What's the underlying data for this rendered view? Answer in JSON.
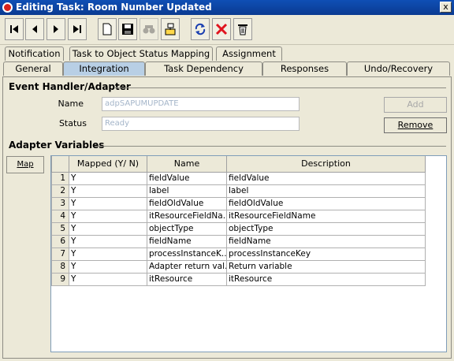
{
  "window": {
    "title": "Editing Task: Room Number Updated",
    "close_glyph": "x"
  },
  "toolbar": {
    "buttons": [
      {
        "name": "first-record-icon"
      },
      {
        "name": "previous-record-icon"
      },
      {
        "name": "next-record-icon"
      },
      {
        "name": "last-record-icon"
      },
      {
        "name": "new-icon"
      },
      {
        "name": "save-icon"
      },
      {
        "name": "find-icon"
      },
      {
        "name": "reorder-icon"
      },
      {
        "name": "refresh-icon"
      },
      {
        "name": "delete-icon"
      },
      {
        "name": "trash-icon"
      }
    ]
  },
  "tabs": {
    "top": [
      "Notification",
      "Task to Object Status Mapping",
      "Assignment"
    ],
    "bottom": [
      "General",
      "Integration",
      "Task Dependency",
      "Responses",
      "Undo/Recovery"
    ],
    "active": "Integration"
  },
  "event_handler": {
    "heading": "Event Handler/Adapter",
    "name_label": "Name",
    "name_value": "adpSAPUMUPDATE",
    "status_label": "Status",
    "status_value": "Ready",
    "add_label": "Add",
    "remove_label": "Remove"
  },
  "adapter_variables": {
    "heading": "Adapter Variables",
    "map_label": "Map",
    "columns": [
      "",
      "Mapped (Y/ N)",
      "Name",
      "Description"
    ],
    "rows": [
      [
        "1",
        "Y",
        "fieldValue",
        "fieldValue"
      ],
      [
        "2",
        "Y",
        "label",
        "label"
      ],
      [
        "3",
        "Y",
        "fieldOldValue",
        "fieldOldValue"
      ],
      [
        "4",
        "Y",
        "itResourceFieldNa...",
        "itResourceFieldName"
      ],
      [
        "5",
        "Y",
        "objectType",
        "objectType"
      ],
      [
        "6",
        "Y",
        "fieldName",
        "fieldName"
      ],
      [
        "7",
        "Y",
        "processInstanceK...",
        "processInstanceKey"
      ],
      [
        "8",
        "Y",
        "Adapter return val...",
        "Return variable"
      ],
      [
        "9",
        "Y",
        "itResource",
        "itResource"
      ]
    ]
  }
}
